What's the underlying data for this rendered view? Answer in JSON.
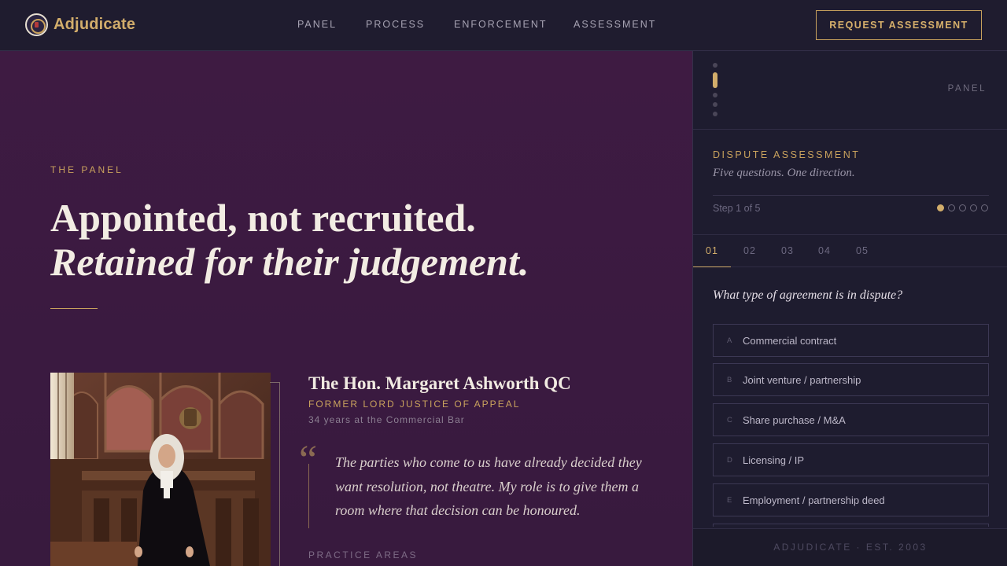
{
  "brand": {
    "name": "Adjudicate"
  },
  "nav": {
    "items": [
      {
        "label": "PANEL"
      },
      {
        "label": "PROCESS"
      },
      {
        "label": "ENFORCEMENT"
      },
      {
        "label": "ASSESSMENT"
      }
    ],
    "cta_label": "REQUEST ASSESSMENT"
  },
  "hero": {
    "eyebrow": "THE PANEL",
    "headline_line1": "Appointed, not recruited.",
    "headline_line2": "Retained for their judgement."
  },
  "profile": {
    "name": "The Hon. Margaret Ashworth QC",
    "role": "FORMER LORD JUSTICE OF APPEAL",
    "meta": "34 years at the Commercial Bar",
    "quote": "The parties who come to us have already decided they want resolution, not theatre. My role is to give them a room where that decision can be honoured.",
    "practice_label": "PRACTICE AREAS"
  },
  "sidebar": {
    "section_label": "PANEL",
    "assessment_title": "DISPUTE ASSESSMENT",
    "assessment_subtitle": "Five questions. One direction.",
    "step_text": "Step 1 of 5",
    "current_step": 1,
    "total_steps": 5,
    "tabs": [
      {
        "label": "01"
      },
      {
        "label": "02"
      },
      {
        "label": "03"
      },
      {
        "label": "04"
      },
      {
        "label": "05"
      }
    ],
    "question": "What type of agreement is in dispute?",
    "options": [
      {
        "letter": "A",
        "text": "Commercial contract"
      },
      {
        "letter": "B",
        "text": "Joint venture / partnership"
      },
      {
        "letter": "C",
        "text": "Share purchase / M&A"
      },
      {
        "letter": "D",
        "text": "Licensing / IP"
      },
      {
        "letter": "E",
        "text": "Employment / partnership deed"
      }
    ],
    "footer": "ADJUDICATE · EST. 2003"
  },
  "colors": {
    "accent_gold": "#c9a25d",
    "hero_bg": "#3e1b42",
    "sidebar_bg": "#1e1c2f"
  }
}
